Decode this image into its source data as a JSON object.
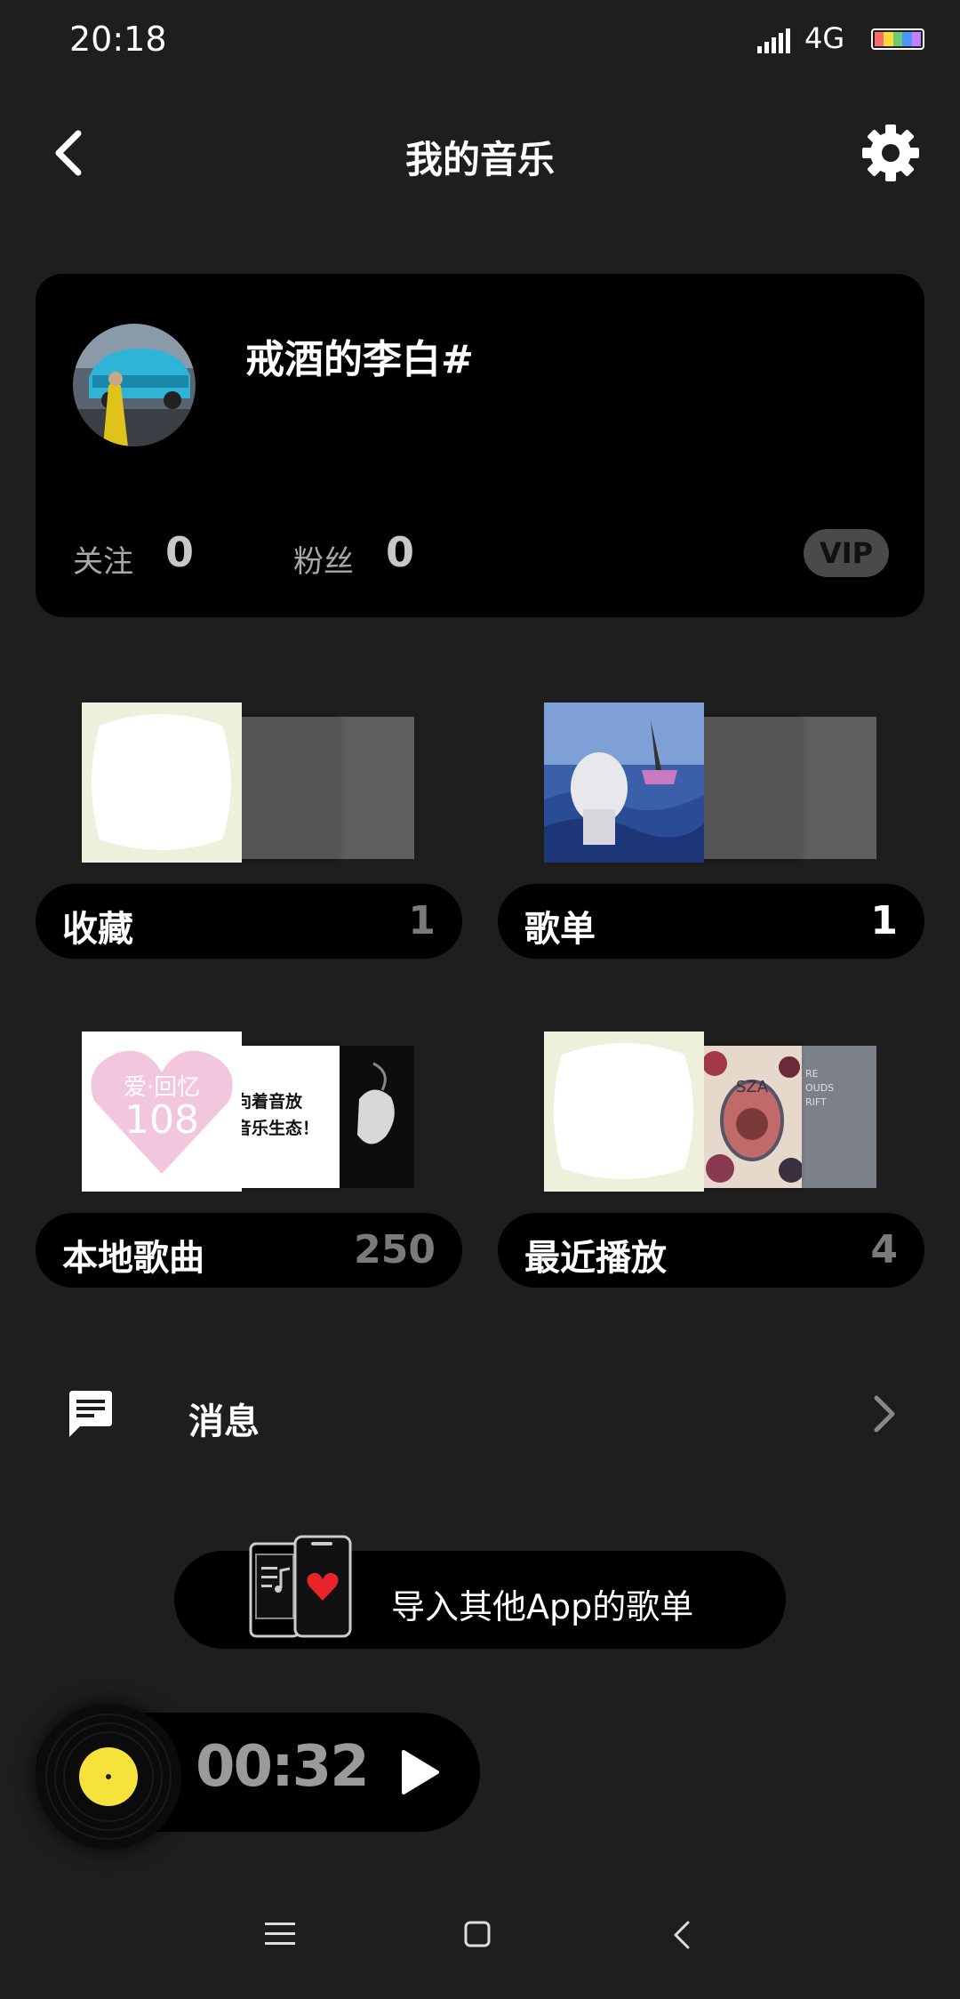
{
  "status_bar": {
    "time": "20:18",
    "network": "4G"
  },
  "header": {
    "title": "我的音乐",
    "back_icon": "chevron-left-icon",
    "settings_icon": "gear-icon"
  },
  "profile": {
    "username": "戒酒的李白#",
    "following_label": "关注",
    "following_count": "0",
    "followers_label": "粉丝",
    "followers_count": "0",
    "vip_label": "VIP"
  },
  "library": [
    {
      "label": "收藏",
      "count": "1"
    },
    {
      "label": "歌单",
      "count": "1"
    },
    {
      "label": "本地歌曲",
      "count": "250"
    },
    {
      "label": "最近播放",
      "count": "4"
    }
  ],
  "cover_texts": {
    "memory_title": "爱·回忆",
    "memory_number": "108",
    "poster_text": "向着音放\n音乐生态！",
    "sza_text": "SZA",
    "clouds_text": "RE\nOUDS\nRIFT"
  },
  "messages": {
    "label": "消息",
    "icon": "message-icon"
  },
  "import": {
    "label": "导入其他App的歌单",
    "icon": "phones-heart-icon"
  },
  "player": {
    "time": "00:32",
    "play_icon": "play-icon"
  },
  "colors": {
    "background": "#1e1e1e",
    "card": "#000000",
    "accent_yellow": "#f5e23a",
    "heart_red": "#e8242b"
  }
}
